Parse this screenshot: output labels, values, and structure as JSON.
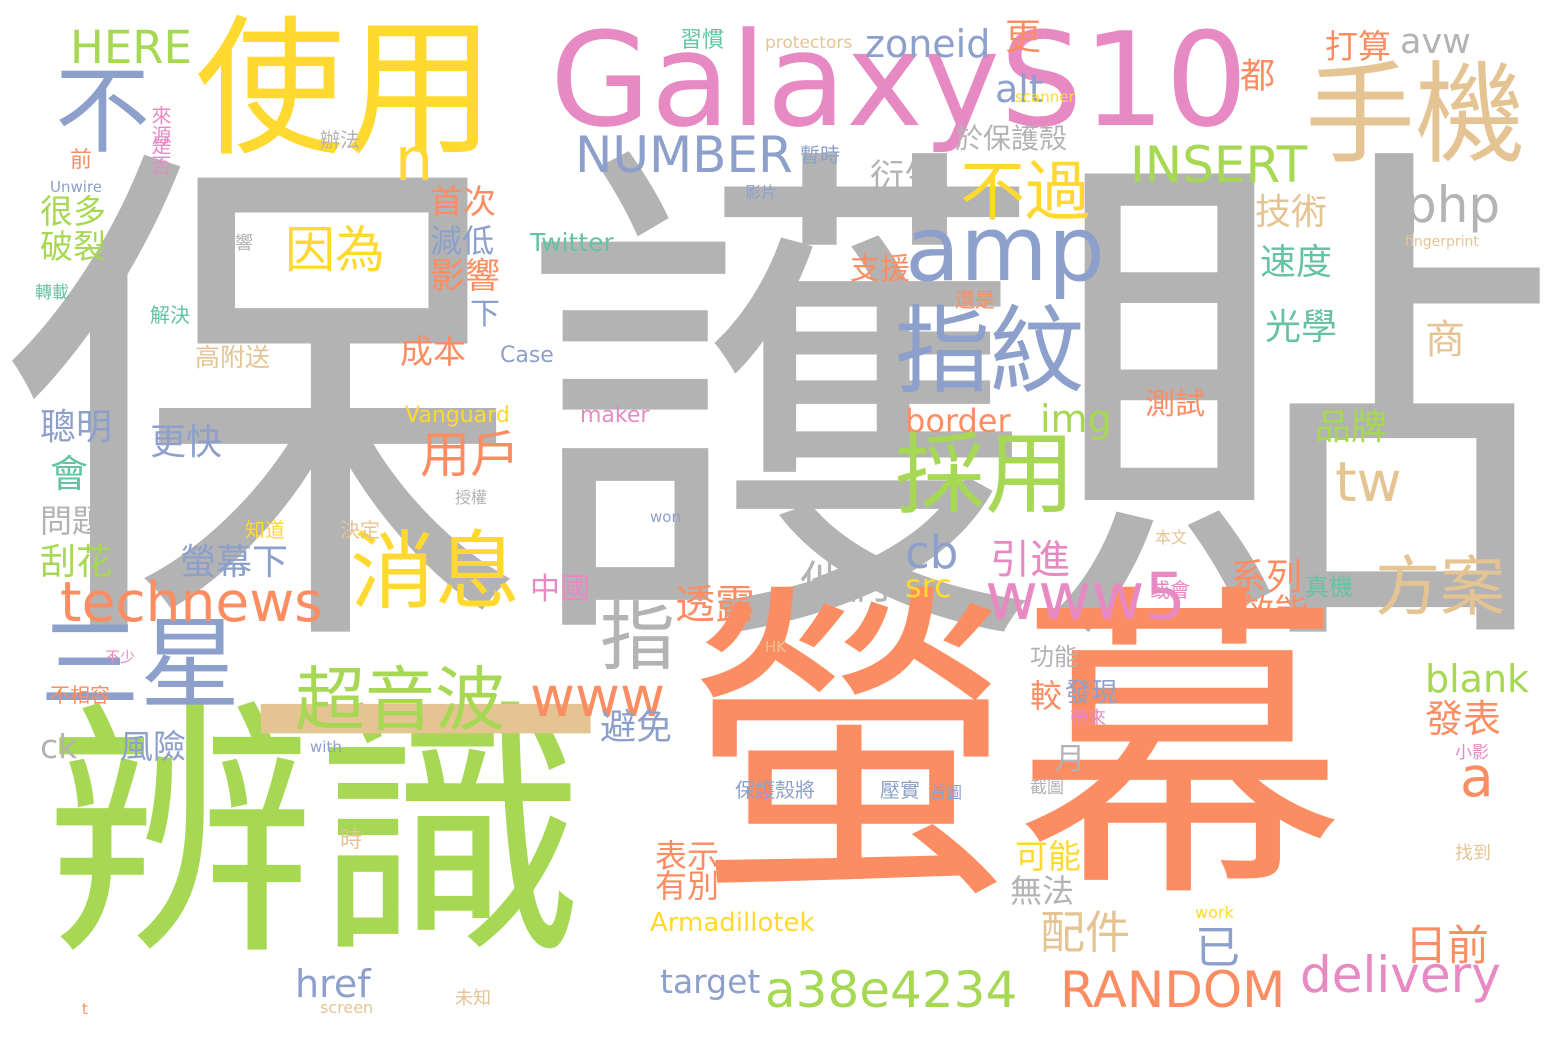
{
  "palette": {
    "gray": "#b3b3b3",
    "orange": "#fc8d62",
    "green": "#a6d854",
    "yellow": "#ffd92f",
    "pink": "#e78ac3",
    "blue": "#8da0cb",
    "tan": "#e5c494",
    "teal": "#66c2a5"
  },
  "words": [
    {
      "text": "保護貼",
      "color": "gray"
    },
    {
      "text": "螢幕",
      "color": "orange"
    },
    {
      "text": "辨識",
      "color": "green"
    },
    {
      "text": "使用",
      "color": "yellow"
    },
    {
      "text": "Galaxy",
      "color": "pink"
    },
    {
      "text": "S10",
      "color": "pink"
    },
    {
      "text": "手機",
      "color": "tan"
    },
    {
      "text": "不",
      "color": "blue"
    },
    {
      "text": "amp",
      "color": "blue"
    },
    {
      "text": "指紋",
      "color": "blue"
    },
    {
      "text": "採用",
      "color": "green"
    },
    {
      "text": "三星",
      "color": "blue"
    },
    {
      "text": "消息",
      "color": "yellow"
    },
    {
      "text": "一",
      "color": "tan"
    },
    {
      "text": "指",
      "color": "gray"
    },
    {
      "text": "超音波",
      "color": "green"
    },
    {
      "text": "technews",
      "color": "orange"
    },
    {
      "text": "www5",
      "color": "pink"
    },
    {
      "text": "方案",
      "color": "tan"
    },
    {
      "text": "不過",
      "color": "yellow"
    },
    {
      "text": "INSERT",
      "color": "green"
    },
    {
      "text": "NUMBER",
      "color": "blue"
    },
    {
      "text": "php",
      "color": "gray"
    },
    {
      "text": "因為",
      "color": "yellow"
    },
    {
      "text": "tw",
      "color": "tan"
    },
    {
      "text": "www",
      "color": "orange"
    },
    {
      "text": "a38e4234",
      "color": "green"
    },
    {
      "text": "RANDOM",
      "color": "orange"
    },
    {
      "text": "delivery",
      "color": "pink"
    },
    {
      "text": "HERE",
      "color": "green"
    },
    {
      "text": "n",
      "color": "yellow"
    },
    {
      "text": "zoneid",
      "color": "blue"
    },
    {
      "text": "avw",
      "color": "gray"
    },
    {
      "text": "alt",
      "color": "blue"
    },
    {
      "text": "更",
      "color": "orange"
    },
    {
      "text": "打算",
      "color": "orange"
    },
    {
      "text": "都",
      "color": "orange"
    },
    {
      "text": "於保護殼",
      "color": "gray"
    },
    {
      "text": "衍生",
      "color": "gray"
    },
    {
      "text": "技術",
      "color": "tan"
    },
    {
      "text": "速度",
      "color": "teal"
    },
    {
      "text": "光學",
      "color": "teal"
    },
    {
      "text": "商",
      "color": "tan"
    },
    {
      "text": "cb",
      "color": "blue"
    },
    {
      "text": "他們",
      "color": "gray"
    },
    {
      "text": "用戶",
      "color": "orange"
    },
    {
      "text": "border",
      "color": "orange"
    },
    {
      "text": "img",
      "color": "green"
    },
    {
      "text": "src",
      "color": "yellow"
    },
    {
      "text": "品牌",
      "color": "green"
    },
    {
      "text": "系列",
      "color": "orange"
    },
    {
      "text": "效能",
      "color": "orange"
    },
    {
      "text": "a",
      "color": "orange"
    },
    {
      "text": "blank",
      "color": "green"
    },
    {
      "text": "發表",
      "color": "orange"
    },
    {
      "text": "日前",
      "color": "orange"
    },
    {
      "text": "已",
      "color": "blue"
    },
    {
      "text": "配件",
      "color": "tan"
    },
    {
      "text": "可能",
      "color": "yellow"
    },
    {
      "text": "無法",
      "color": "gray"
    },
    {
      "text": "有別",
      "color": "orange"
    },
    {
      "text": "表示",
      "color": "orange"
    },
    {
      "text": "避免",
      "color": "blue"
    },
    {
      "text": "透露",
      "color": "orange"
    },
    {
      "text": "中國",
      "color": "pink"
    },
    {
      "text": "引進",
      "color": "pink"
    },
    {
      "text": "螢幕下",
      "color": "blue"
    },
    {
      "text": "刮花",
      "color": "green"
    },
    {
      "text": "問題",
      "color": "gray"
    },
    {
      "text": "會",
      "color": "teal"
    },
    {
      "text": "聰明",
      "color": "blue"
    },
    {
      "text": "更快",
      "color": "blue"
    },
    {
      "text": "風險",
      "color": "blue"
    },
    {
      "text": "ck",
      "color": "gray"
    },
    {
      "text": "很多",
      "color": "green"
    },
    {
      "text": "破裂",
      "color": "green"
    },
    {
      "text": "首次",
      "color": "orange"
    },
    {
      "text": "減低",
      "color": "blue"
    },
    {
      "text": "影響",
      "color": "orange"
    },
    {
      "text": "下",
      "color": "blue"
    },
    {
      "text": "成本",
      "color": "orange"
    },
    {
      "text": "Twitter",
      "color": "teal"
    },
    {
      "text": "支援",
      "color": "orange"
    },
    {
      "text": "href",
      "color": "blue"
    },
    {
      "text": "target",
      "color": "blue"
    },
    {
      "text": "Armadillotek",
      "color": "yellow"
    },
    {
      "text": "月",
      "color": "gray"
    },
    {
      "text": "較",
      "color": "orange"
    },
    {
      "text": "發現",
      "color": "blue"
    },
    {
      "text": "測試",
      "color": "orange"
    },
    {
      "text": "Vanguard",
      "color": "yellow"
    },
    {
      "text": "maker",
      "color": "pink"
    },
    {
      "text": "高附送",
      "color": "tan"
    },
    {
      "text": "Case",
      "color": "blue"
    },
    {
      "text": "習慣",
      "color": "teal"
    },
    {
      "text": "protectors",
      "color": "tan"
    },
    {
      "text": "scanner",
      "color": "yellow"
    },
    {
      "text": "辦法",
      "color": "gray"
    },
    {
      "text": "暫時",
      "color": "blue"
    },
    {
      "text": "影片",
      "color": "blue"
    },
    {
      "text": "來源",
      "color": "pink"
    },
    {
      "text": "是否",
      "color": "pink"
    },
    {
      "text": "前",
      "color": "orange"
    },
    {
      "text": "Unwire",
      "color": "blue"
    },
    {
      "text": "響",
      "color": "gray"
    },
    {
      "text": "轉載",
      "color": "teal"
    },
    {
      "text": "解決",
      "color": "teal"
    },
    {
      "text": "還是",
      "color": "orange"
    },
    {
      "text": "fingerprint",
      "color": "tan"
    },
    {
      "text": "授權",
      "color": "gray"
    },
    {
      "text": "知道",
      "color": "yellow"
    },
    {
      "text": "決定",
      "color": "tan"
    },
    {
      "text": "won",
      "color": "blue"
    },
    {
      "text": "本文",
      "color": "tan"
    },
    {
      "text": "或會",
      "color": "pink"
    },
    {
      "text": "真機",
      "color": "teal"
    },
    {
      "text": "HK",
      "color": "tan"
    },
    {
      "text": "不少",
      "color": "pink"
    },
    {
      "text": "不相容",
      "color": "orange"
    },
    {
      "text": "with",
      "color": "blue"
    },
    {
      "text": "帶來",
      "color": "pink"
    },
    {
      "text": "保護殼將",
      "color": "blue"
    },
    {
      "text": "壓實",
      "color": "blue"
    },
    {
      "text": "首圖",
      "color": "blue"
    },
    {
      "text": "截圖",
      "color": "gray"
    },
    {
      "text": "功能",
      "color": "gray"
    },
    {
      "text": "小影",
      "color": "pink"
    },
    {
      "text": "時",
      "color": "tan"
    },
    {
      "text": "找到",
      "color": "tan"
    },
    {
      "text": "work",
      "color": "yellow"
    },
    {
      "text": "未知",
      "color": "tan"
    },
    {
      "text": "screen",
      "color": "tan"
    },
    {
      "text": "t",
      "color": "orange"
    }
  ]
}
